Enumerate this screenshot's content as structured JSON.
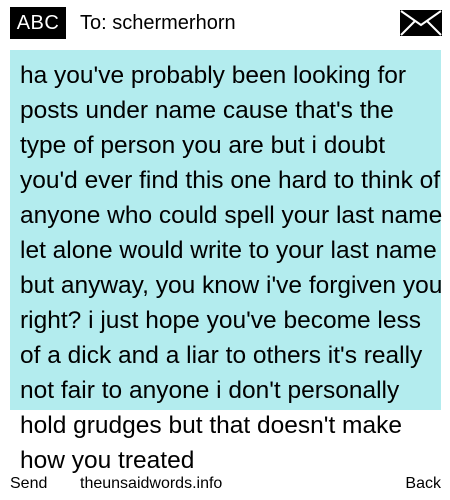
{
  "header": {
    "input_mode": "ABC",
    "recipient": "To: schermerhorn",
    "message_icon": "envelope-icon"
  },
  "message": {
    "text": "ha you've probably been looking for posts under name cause that's the type of person you are but i doubt you'd ever find this one hard to think of anyone who could spell your last name let alone would write to your last name but anyway, you know i've forgiven you right? i just hope you've become less of a dick and a liar to others it's really not fair to anyone i don't personally hold grudges but that doesn't make how you treated",
    "highlight_color": "#b3ecee"
  },
  "footer": {
    "left_softkey": "Send",
    "site": "theunsaidwords.info",
    "right_softkey": "Back"
  }
}
